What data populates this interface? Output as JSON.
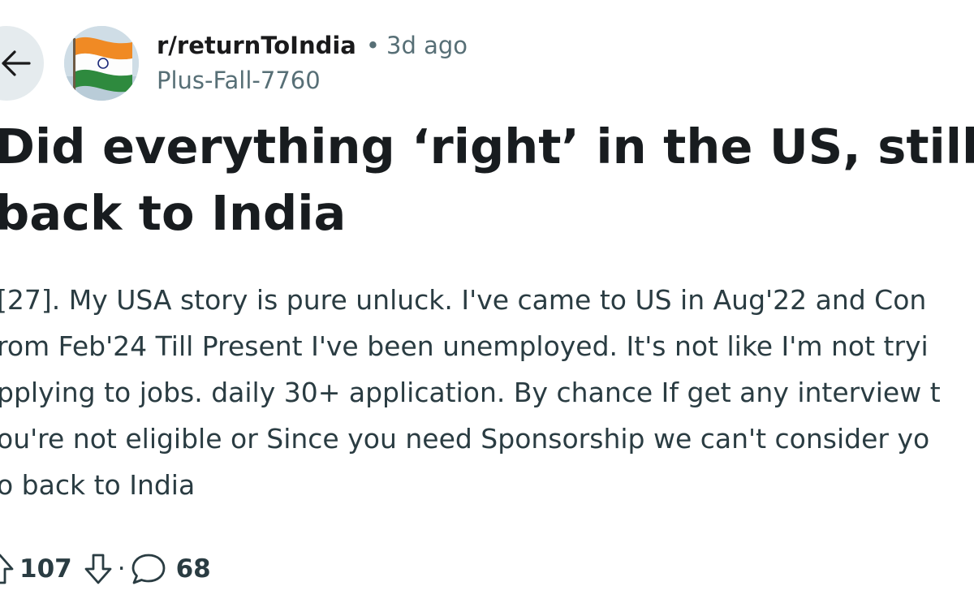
{
  "post": {
    "subreddit": "r/returnToIndia",
    "separator": "•",
    "time": "3d ago",
    "author": "Plus-Fall-7760",
    "title_lines": [
      "Did everything ‘right’ in the US, still fa",
      "back to India"
    ],
    "body_lines": [
      "[27]. My USA story is pure unluck. I've came to US in Aug'22 and Con",
      "rom Feb'24 Till Present I've been unemployed. It's not like I'm not tryi",
      "pplying to jobs. daily 30+ application. By chance If get any interview t",
      "ou're not eligible or Since you need Sponsorship we can't consider yo",
      "o back to India"
    ]
  },
  "actions": {
    "upvotes": "107",
    "separator": "·",
    "comments": "68"
  },
  "icons": {
    "back": "arrow-left-icon",
    "upvote": "upvote-arrow-icon",
    "downvote": "downvote-arrow-icon",
    "comment": "comment-bubble-icon"
  },
  "colors": {
    "text_primary": "#1a1a1b",
    "text_meta": "#576f76",
    "text_body": "#2a3c42",
    "back_button_bg": "#e5ebee"
  }
}
